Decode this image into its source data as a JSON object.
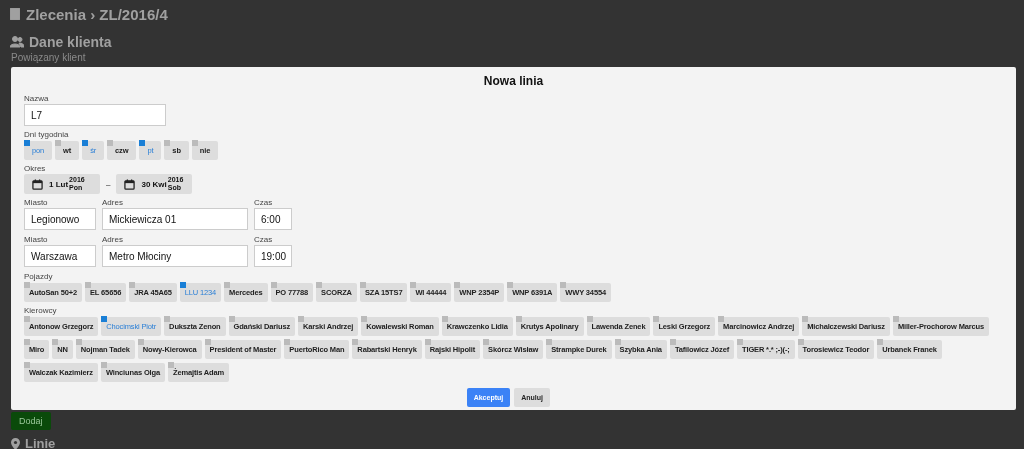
{
  "page": {
    "breadcrumb": "Zlecenia › ZL/2016/4",
    "section_title": "Dane klienta",
    "subtitle": "Powiązany klient",
    "add_button": "Dodaj",
    "lines_title": "Linie"
  },
  "dialog": {
    "title": "Nowa linia",
    "name": {
      "label": "Nazwa",
      "value": "L7"
    },
    "days_label": "Dni tygodnia",
    "days": [
      {
        "label": "pon",
        "selected": true
      },
      {
        "label": "wt",
        "selected": false
      },
      {
        "label": "śr",
        "selected": true
      },
      {
        "label": "czw",
        "selected": false
      },
      {
        "label": "pt",
        "selected": true
      },
      {
        "label": "sb",
        "selected": false
      },
      {
        "label": "nie",
        "selected": false
      }
    ],
    "period_label": "Okres",
    "period": {
      "start": {
        "day": "1 Lut",
        "year": "2016",
        "weekday": "Pon"
      },
      "separator": "–",
      "end": {
        "day": "30 Kwi",
        "year": "2016",
        "weekday": "Sob"
      }
    },
    "stops": [
      {
        "city_label": "Miasto",
        "city": "Legionowo",
        "address_label": "Adres",
        "address": "Mickiewicza 01",
        "time_label": "Czas",
        "time": "6:00"
      },
      {
        "city_label": "Miasto",
        "city": "Warszawa",
        "address_label": "Adres",
        "address": "Metro Młociny",
        "time_label": "Czas",
        "time": "19:00"
      }
    ],
    "vehicles_label": "Pojazdy",
    "vehicles": [
      {
        "label": "AutoSan 50+2",
        "selected": false
      },
      {
        "label": "EL 65656",
        "selected": false
      },
      {
        "label": "JRA 45A65",
        "selected": false
      },
      {
        "label": "LLU 1234",
        "selected": true
      },
      {
        "label": "Mercedes",
        "selected": false
      },
      {
        "label": "PO 77788",
        "selected": false
      },
      {
        "label": "SCORZA",
        "selected": false
      },
      {
        "label": "SZA 15TS7",
        "selected": false
      },
      {
        "label": "WI 44444",
        "selected": false
      },
      {
        "label": "WNP 2354P",
        "selected": false
      },
      {
        "label": "WNP 6391A",
        "selected": false
      },
      {
        "label": "WWY 34554",
        "selected": false
      }
    ],
    "drivers_label": "Kierowcy",
    "drivers": [
      {
        "label": "Antonow Grzegorz",
        "selected": false
      },
      {
        "label": "Chocimski Piotr",
        "selected": true
      },
      {
        "label": "Dukszta Zenon",
        "selected": false
      },
      {
        "label": "Gdański Dariusz",
        "selected": false
      },
      {
        "label": "Karski Andrzej",
        "selected": false
      },
      {
        "label": "Kowalewski Roman",
        "selected": false
      },
      {
        "label": "Krawczenko Lidia",
        "selected": false
      },
      {
        "label": "Krutys Apolinary",
        "selected": false
      },
      {
        "label": "Lawenda Zenek",
        "selected": false
      },
      {
        "label": "Leski Grzegorz",
        "selected": false
      },
      {
        "label": "Marcinowicz Andrzej",
        "selected": false
      },
      {
        "label": "Michalczewski Dariusz",
        "selected": false
      },
      {
        "label": "Miller-Prochorow Marcus",
        "selected": false
      },
      {
        "label": "Miro",
        "selected": false
      },
      {
        "label": "NN",
        "selected": false
      },
      {
        "label": "Nojman Tadek",
        "selected": false
      },
      {
        "label": "Nowy-Kierowca",
        "selected": false
      },
      {
        "label": "President of Master",
        "selected": false
      },
      {
        "label": "PuertoRico Man",
        "selected": false
      },
      {
        "label": "Rabartski Henryk",
        "selected": false
      },
      {
        "label": "Rajski Hipolit",
        "selected": false
      },
      {
        "label": "Skórcz Wisław",
        "selected": false
      },
      {
        "label": "Strampke Durek",
        "selected": false
      },
      {
        "label": "Szybka Ania",
        "selected": false
      },
      {
        "label": "Tafilowicz Józef",
        "selected": false
      },
      {
        "label": "TIGER *.* ;-)(-;",
        "selected": false
      },
      {
        "label": "Torosiewicz Teodor",
        "selected": false
      },
      {
        "label": "Urbanek Franek",
        "selected": false
      },
      {
        "label": "Walczak Kazimierz",
        "selected": false
      },
      {
        "label": "Winciunas Olga",
        "selected": false
      },
      {
        "label": "Żemajtis Adam",
        "selected": false
      }
    ],
    "buttons": [
      {
        "label": "Akceptuj",
        "kind": "primary"
      },
      {
        "label": "Anuluj",
        "kind": "secondary"
      }
    ]
  }
}
